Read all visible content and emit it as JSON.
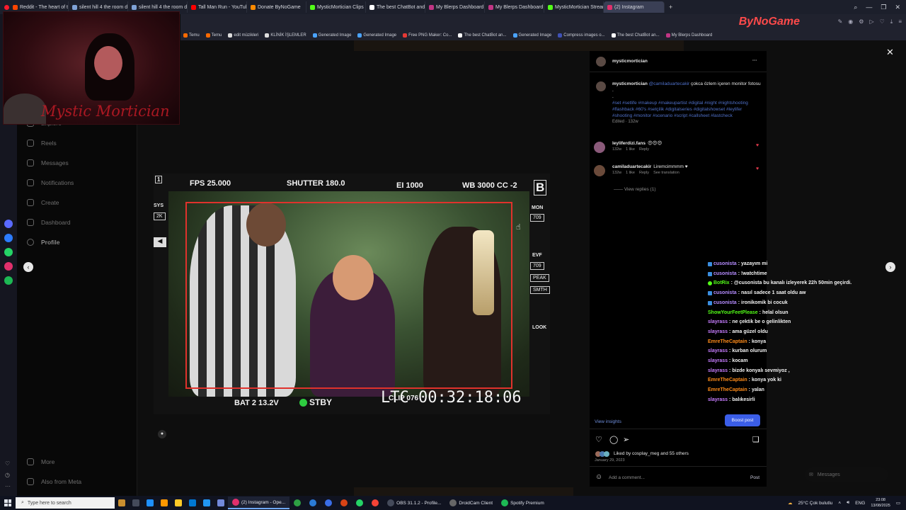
{
  "browser": {
    "tabs": [
      {
        "label": "Reddit - The heart of the...",
        "color": "#ff4500"
      },
      {
        "label": "silent hill 4 the room doo...",
        "color": "#7fa2d6"
      },
      {
        "label": "silent hill 4 the room doo...",
        "color": "#7fa2d6"
      },
      {
        "label": "Tall Man Run - YouTube",
        "color": "#ff0000"
      },
      {
        "label": "Donate ByNoGame",
        "color": "#ff8a00"
      },
      {
        "label": "MysticMortician Clips - W...",
        "color": "#53fc18"
      },
      {
        "label": "The best ChatBot and Wi...",
        "color": "#ffffff"
      },
      {
        "label": "My Blerps Dashboard",
        "color": "#c13584"
      },
      {
        "label": "My Blerps Dashboard",
        "color": "#c13584"
      },
      {
        "label": "MysticMortician Stream ...",
        "color": "#53fc18"
      },
      {
        "label": "(2) Instagram",
        "color": "#e1306c"
      }
    ],
    "new_tab": "+",
    "window_controls": [
      "⌕",
      "—",
      "❐",
      "✕"
    ],
    "bookmarks": [
      "Temu",
      "Temu",
      "edit müzikleri",
      "KLİNİK İŞLEMLER",
      "Generated Image",
      "Generated Image",
      "Free PNG Maker: Co...",
      "The best ChatBot an...",
      "Generated Image",
      "Compress images o...",
      "The best ChatBot an...",
      "My Blerps Dashboard"
    ],
    "watermark": "ByNoGame"
  },
  "webcam": {
    "overlay_name": "Mystic Mortician"
  },
  "instagram": {
    "nav": [
      {
        "label": "Explore",
        "bold": false
      },
      {
        "label": "Reels",
        "bold": false
      },
      {
        "label": "Messages",
        "bold": false
      },
      {
        "label": "Notifications",
        "bold": false
      },
      {
        "label": "Create",
        "bold": false
      },
      {
        "label": "Dashboard",
        "bold": false
      },
      {
        "label": "Profile",
        "bold": true
      }
    ],
    "more": "More",
    "also_from_meta": "Also from Meta",
    "close": "✕",
    "prev": "‹",
    "next": "›",
    "photo": {
      "fps": "FPS 25.000",
      "shutter": "SHUTTER 180.0",
      "ei": "EI 1000",
      "wb": "WB 3000 CC -2",
      "b_label": "B",
      "sys": "SYS",
      "sys_val": "2K",
      "mon": "MON",
      "mon_val": "709",
      "evf": "EVF",
      "evf_val": "709",
      "peak": "PEAK",
      "smth": "SMTH",
      "look": "LOOK",
      "bat": "BAT 2 13.2V",
      "stby": "STBY",
      "clip": "CLIP 076",
      "timecode": "LTC 00:32:18:06",
      "corner": "1"
    },
    "post": {
      "author": "mysticmortician",
      "menu": "···",
      "caption_user": "mysticmortician",
      "caption_mention": "@camiladuartecakir",
      "caption_text": "çokca özlem içeren monitor fotosu",
      "caption_dots": ".",
      "hashtags": "#set #setlife #makeup #makeupartist #digital #night #nightshooting #flashback #60's #setçilik #digitalseries #digitalshowset #leylifer #shooting #monitor #scenario #script #callsheet #lastcheck",
      "edited": "Edited · 132w",
      "comments": [
        {
          "user": "leyliferdizi.fans",
          "text": "😍😍😍",
          "age": "132w",
          "likes": "1 like",
          "reply": "Reply",
          "extra": ""
        },
        {
          "user": "camiladuartecakir",
          "text": "Liremcimmmm ♥",
          "age": "132w",
          "likes": "1 like",
          "reply": "Reply",
          "extra": "See translation"
        }
      ],
      "view_replies": "View replies (1)",
      "view_insights": "View insights",
      "boost": "Boost post",
      "liked_by": "Liked by cosplay_meg and 55 others",
      "date": "January 29, 2023",
      "add_comment": "Add a comment...",
      "post_btn": "Post"
    },
    "messages_float": "Messages"
  },
  "chat": [
    {
      "user": "cusonista",
      "color": "#b58cff",
      "badge": true,
      "msg": "yazayım mi"
    },
    {
      "user": "cusonista",
      "color": "#b58cff",
      "badge": true,
      "msg": "!watchtime"
    },
    {
      "user": "BotRix",
      "color": "#53fc18",
      "badge": true,
      "msg": "@cusonista bu kanalı izleyerek 22h 50min geçirdi."
    },
    {
      "user": "cusonista",
      "color": "#b58cff",
      "badge": true,
      "msg": "nasıl sadece 1 saat oldu aw"
    },
    {
      "user": "cusonista",
      "color": "#b58cff",
      "badge": true,
      "msg": "ironikomik bi cocuk"
    },
    {
      "user": "ShowYourFeetPlease",
      "color": "#53fc18",
      "badge": false,
      "msg": "helal olsun"
    },
    {
      "user": "slayrass",
      "color": "#c77dff",
      "badge": false,
      "msg": "ne çektik be o gelinlikten"
    },
    {
      "user": "slayrass",
      "color": "#c77dff",
      "badge": false,
      "msg": "ama güzel oldu"
    },
    {
      "user": "EmreTheCaptain",
      "color": "#ff8c1a",
      "badge": false,
      "msg": "konya"
    },
    {
      "user": "slayrass",
      "color": "#c77dff",
      "badge": false,
      "msg": "kurban olurum"
    },
    {
      "user": "slayrass",
      "color": "#c77dff",
      "badge": false,
      "msg": "kocam"
    },
    {
      "user": "slayrass",
      "color": "#c77dff",
      "badge": false,
      "msg": "bizde konyalı sevmiyoz ,"
    },
    {
      "user": "EmreTheCaptain",
      "color": "#ff8c1a",
      "badge": false,
      "msg": "konya yok ki"
    },
    {
      "user": "EmreTheCaptain",
      "color": "#ff8c1a",
      "badge": false,
      "msg": "yalan"
    },
    {
      "user": "slayrass",
      "color": "#c77dff",
      "badge": false,
      "msg": "balıkesirli"
    }
  ],
  "taskbar": {
    "search_placeholder": "Type here to search",
    "apps": [
      {
        "label": "(2) Instagram - Ope...",
        "color": "#e1306c",
        "active": true
      },
      {
        "label": "",
        "color": "#2ea043",
        "active": false
      },
      {
        "label": "",
        "color": "#2b7bd6",
        "active": false
      },
      {
        "label": "",
        "color": "#3a6ee8",
        "active": false
      },
      {
        "label": "",
        "color": "#d84315",
        "active": false
      },
      {
        "label": "",
        "color": "#25d366",
        "active": false
      },
      {
        "label": "",
        "color": "#f44336",
        "active": false
      },
      {
        "label": "OBS 31.1.2 - Profile...",
        "color": "#444a5a",
        "active": false
      },
      {
        "label": "DroidCam Client",
        "color": "#666",
        "active": false
      },
      {
        "label": "Spotify Premium",
        "color": "#1db954",
        "active": false
      }
    ],
    "weather": "25°C  Çok bulutlu",
    "lang": "ENG",
    "time": "23:08",
    "date": "13/08/2025"
  }
}
